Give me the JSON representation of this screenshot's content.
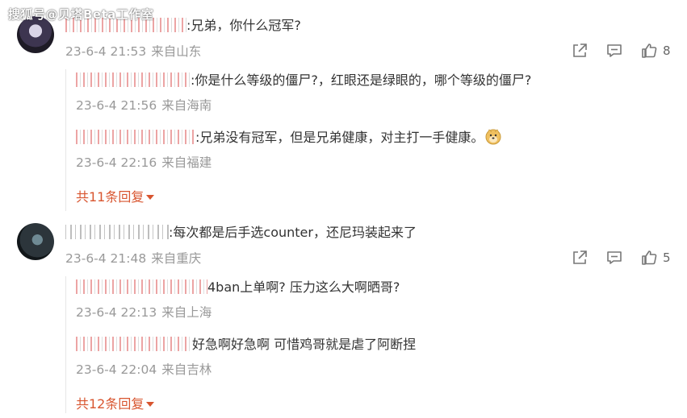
{
  "watermark": "搜狐号@贝塔Beta工作室",
  "comments": [
    {
      "text": ":兄弟，你什么冠军?",
      "time": "23-6-4 21:53",
      "location": "来自山东",
      "likes": "8",
      "replies": [
        {
          "text": ":你是什么等级的僵尸?，红眼还是绿眼的，哪个等级的僵尸?",
          "time": "23-6-4 21:56",
          "location": "来自海南"
        },
        {
          "text": ":兄弟没有冠军，但是兄弟健康，对主打一手健康。",
          "time": "23-6-4 22:16",
          "location": "来自福建",
          "emoji": "doge-emoji"
        }
      ],
      "more": "共11条回复"
    },
    {
      "text": ":每次都是后手选counter，还尼玛装起来了",
      "time": "23-6-4 21:48",
      "location": "来自重庆",
      "likes": "5",
      "replies": [
        {
          "text": "4ban上单啊? 压力这么大啊晒哥?",
          "time": "23-6-4 22:13",
          "location": "来自上海"
        },
        {
          "text": "好急啊好急啊 可惜鸡哥就是虐了阿断捏",
          "time": "23-6-4 22:04",
          "location": "来自吉林"
        }
      ],
      "more": "共12条回复"
    }
  ],
  "icons": {
    "share": "share-icon",
    "comment": "comment-icon",
    "like": "thumbs-up-icon"
  },
  "colors": {
    "accent": "#d8552f",
    "meta": "#999999",
    "text": "#333333"
  }
}
